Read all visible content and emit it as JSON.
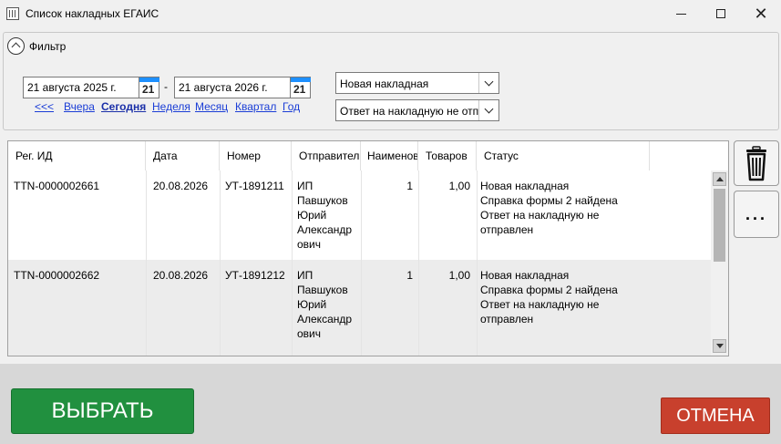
{
  "window": {
    "title": "Список накладных ЕГАИС",
    "icon": "table-app-icon"
  },
  "filter": {
    "label": "Фильтр",
    "date_from": "21 августа 2025 г.",
    "date_to": "21 августа 2026 г.",
    "date_separator": "-",
    "calendar_day": "21",
    "periods": [
      "<<<",
      "Вчера",
      "Сегодня",
      "Неделя",
      "Месяц",
      "Квартал",
      "Год"
    ],
    "active_period": "Сегодня",
    "status_combo": "Новая накладная",
    "answer_combo": "Ответ на накладную не отправлен"
  },
  "table": {
    "columns": [
      "Рег. ИД",
      "Дата",
      "Номер",
      "Отправитель",
      "Наименований",
      "Товаров",
      "Статус"
    ],
    "rows": [
      {
        "reg_id": "TTN-0000002661",
        "date": "20.08.2026",
        "number": "УТ-1891211",
        "sender": "ИП Павшуков Юрий Александрович",
        "sender_lines": [
          "ИП",
          "Павшуков",
          "Юрий",
          "Александр",
          "ович"
        ],
        "items": "1",
        "goods": "1,00",
        "status_lines": [
          "Новая накладная",
          "Справка формы 2 найдена",
          "Ответ на накладную не",
          "отправлен"
        ]
      },
      {
        "reg_id": "TTN-0000002662",
        "date": "20.08.2026",
        "number": "УТ-1891212",
        "sender": "ИП Павшуков Юрий Александрович",
        "sender_lines": [
          "ИП",
          "Павшуков",
          "Юрий",
          "Александр",
          "ович"
        ],
        "items": "1",
        "goods": "1,00",
        "status_lines": [
          "Новая накладная",
          "Справка формы 2 найдена",
          "Ответ на накладную не",
          "отправлен"
        ]
      }
    ]
  },
  "side_buttons": {
    "delete_icon": "trash-icon",
    "more_label": "..."
  },
  "buttons": {
    "select": "ВЫБРАТЬ",
    "cancel": "ОТМЕНА"
  },
  "colors": {
    "select_button": "#21903f",
    "cancel_button": "#c8402d",
    "link": "#1a3dd6",
    "calendar_accent": "#1e90ff",
    "alt_row": "#ececec"
  }
}
